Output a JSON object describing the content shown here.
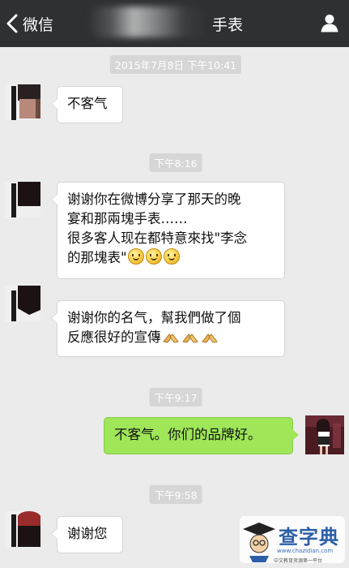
{
  "header": {
    "back_label": "微信",
    "title": "手表"
  },
  "messages": [
    {
      "type": "timestamp",
      "text": "2015年7月8日 下午10:41"
    },
    {
      "type": "received",
      "text": "不客气"
    },
    {
      "type": "timestamp",
      "text": "下午8:16"
    },
    {
      "type": "received",
      "lines": [
        "谢谢你在微博分享了那天的晚",
        "宴和那兩塊手表……",
        "很多客人现在都特意來找\"李念",
        "的那塊表\""
      ],
      "emoji": [
        "smile",
        "smile",
        "smile"
      ]
    },
    {
      "type": "received",
      "lines": [
        "谢谢你的名气，幫我們做了個",
        "反應很好的宣傳"
      ],
      "emoji": [
        "clap-hands",
        "clap-hands",
        "clap-hands"
      ]
    },
    {
      "type": "timestamp",
      "text": "下午9:17"
    },
    {
      "type": "sent",
      "text": "不客气。你们的品牌好。"
    },
    {
      "type": "timestamp",
      "text": "下午9:58"
    },
    {
      "type": "received",
      "text": "谢谢您"
    }
  ],
  "watermark": {
    "name": "查字典",
    "site": "www.chazidian.com",
    "sub": "中文教育资源第一平台"
  },
  "colors": {
    "header_bg": "#2e3132",
    "chat_bg": "#ebebeb",
    "sent_bubble": "#9fe658",
    "received_bubble": "#ffffff",
    "timestamp_bg": "#d6d6d6"
  }
}
